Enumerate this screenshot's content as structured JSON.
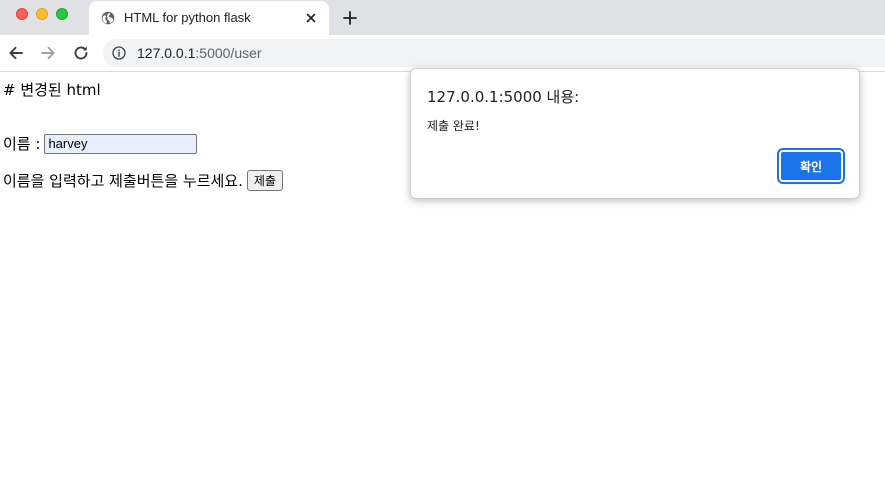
{
  "browser": {
    "tab_title": "HTML for python flask",
    "url_host": "127.0.0.1",
    "url_rest": ":5000/user"
  },
  "page": {
    "heading": "# 변경된 html",
    "name_label": "이름 :",
    "name_value": "harvey",
    "instruction": "이름을 입력하고 제출버튼을 누르세요.",
    "submit_label": "제출"
  },
  "dialog": {
    "title": "127.0.0.1:5000 내용:",
    "message": "제출 완료!",
    "ok_label": "확인"
  },
  "colors": {
    "accent": "#1a73e8",
    "tabstrip": "#dfe1e5",
    "autofill": "#e8f0fe"
  }
}
